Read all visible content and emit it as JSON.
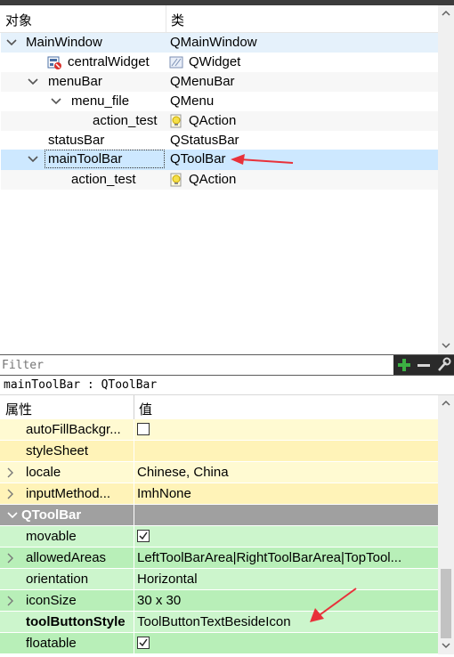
{
  "object_inspector": {
    "headers": {
      "object": "对象",
      "class": "类"
    },
    "rows": [
      {
        "name": "MainWindow",
        "cls": "QMainWindow"
      },
      {
        "name": "centralWidget",
        "cls": "QWidget"
      },
      {
        "name": "menuBar",
        "cls": "QMenuBar"
      },
      {
        "name": "menu_file",
        "cls": "QMenu"
      },
      {
        "name": "action_test",
        "cls": "QAction"
      },
      {
        "name": "statusBar",
        "cls": "QStatusBar"
      },
      {
        "name": "mainToolBar",
        "cls": "QToolBar"
      },
      {
        "name": "action_test",
        "cls": "QAction"
      }
    ]
  },
  "filter": {
    "placeholder": "Filter"
  },
  "property_editor": {
    "object_label": "mainToolBar : QToolBar",
    "headers": {
      "property": "属性",
      "value": "值"
    },
    "rows": [
      {
        "name": "autoFillBackgr...",
        "value": "",
        "checked": false
      },
      {
        "name": "styleSheet",
        "value": ""
      },
      {
        "name": "locale",
        "value": "Chinese, China"
      },
      {
        "name": "inputMethod...",
        "value": "ImhNone"
      },
      {
        "group": "QToolBar"
      },
      {
        "name": "movable",
        "value": "",
        "checked": true
      },
      {
        "name": "allowedAreas",
        "value": "LeftToolBarArea|RightToolBarArea|TopTool..."
      },
      {
        "name": "orientation",
        "value": "Horizontal"
      },
      {
        "name": "iconSize",
        "value": "30 x 30"
      },
      {
        "name": "toolButtonStyle",
        "value": "ToolButtonTextBesideIcon"
      },
      {
        "name": "floatable",
        "value": "",
        "checked": true
      }
    ]
  },
  "colors": {
    "selection": "#cde8ff",
    "annotation_arrow": "#e8313a",
    "yellow_row": "#fffad2",
    "green_row": "#ccf5cc",
    "group_header": "#a0a0a0"
  }
}
